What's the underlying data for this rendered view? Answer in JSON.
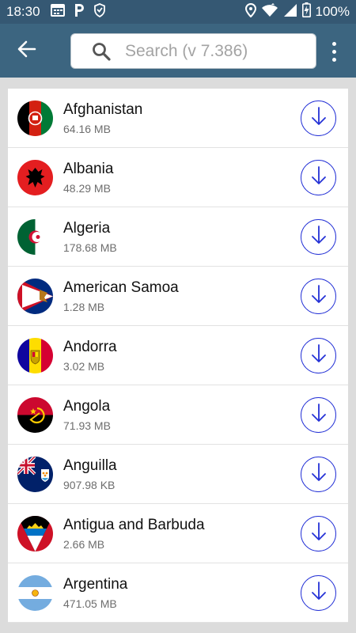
{
  "status_bar": {
    "time": "18:30",
    "battery_text": "100%",
    "left_icons": [
      "calendar-icon",
      "parking-icon",
      "shield-icon"
    ],
    "right_icons": [
      "location-icon",
      "wifi-icon",
      "signal-icon",
      "battery-charging-icon"
    ]
  },
  "app_bar": {
    "back_icon": "arrow-left-icon",
    "search": {
      "placeholder": "Search (v 7.386)",
      "value": ""
    },
    "overflow_icon": "more-vert-icon"
  },
  "colors": {
    "status_bar": "#355873",
    "app_bar": "#3c6580",
    "download_accent": "#2532d6",
    "background": "#dcdcdc"
  },
  "countries": [
    {
      "name": "Afghanistan",
      "size": "64.16 MB",
      "flag": "afghanistan-flag"
    },
    {
      "name": "Albania",
      "size": "48.29 MB",
      "flag": "albania-flag"
    },
    {
      "name": "Algeria",
      "size": "178.68 MB",
      "flag": "algeria-flag"
    },
    {
      "name": "American Samoa",
      "size": "1.28 MB",
      "flag": "american-samoa-flag"
    },
    {
      "name": "Andorra",
      "size": "3.02 MB",
      "flag": "andorra-flag"
    },
    {
      "name": "Angola",
      "size": "71.93 MB",
      "flag": "angola-flag"
    },
    {
      "name": "Anguilla",
      "size": "907.98 KB",
      "flag": "anguilla-flag"
    },
    {
      "name": "Antigua and Barbuda",
      "size": "2.66 MB",
      "flag": "antigua-barbuda-flag"
    },
    {
      "name": "Argentina",
      "size": "471.05 MB",
      "flag": "argentina-flag"
    }
  ],
  "download_icon": "download-arrow-icon"
}
